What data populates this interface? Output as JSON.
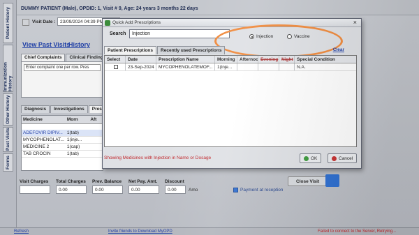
{
  "app": {
    "patient_title": "DUMMY PATIENT (Male), OPDID: 1, Visit # 9, Age: 24 years 3 months 22 days",
    "visit_date_label": "Visit Date :",
    "visit_date_value": "23/09/2024 04:39 PM"
  },
  "left_tabs": [
    "Patient History",
    "Immunization History",
    "Other History",
    "Past Visits",
    "Forms"
  ],
  "links": {
    "view_past_visits": "View Past Visits",
    "history": "History"
  },
  "complaint_tabs": [
    "Chief Complaints",
    "Clinical Findings"
  ],
  "complaint_placeholder": "Enter complaint one per row. Pres",
  "rx_tabs": [
    "Diagnosis",
    "Investigations",
    "Prescrip"
  ],
  "med_table": {
    "headers": [
      "Medicine",
      "Morn",
      "Aft"
    ],
    "rows": [
      [
        "ADEFOVIR DIPIV...",
        "1(tab)",
        ""
      ],
      [
        "MYCOPHENOLAT...",
        "1(inje...",
        ""
      ],
      [
        "MEDICINE 2",
        "1(cap)",
        ""
      ],
      [
        "TAB CROCIN",
        "1(tab)",
        ""
      ]
    ]
  },
  "billing": {
    "visit_charges_label": "Visit Charges",
    "total_charges_label": "Total Charges",
    "total_charges_value": "0.00",
    "prev_balance_label": "Prev. Balance",
    "prev_balance_value": "0.00",
    "net_pay_label": "Net Pay. Amt.",
    "net_pay_value": "0.00",
    "discount_label": "Discount",
    "discount_value": "0.00",
    "discount_unit": "Amo",
    "payment_at_reception": "Payment at reception",
    "close_visit": "Close Visit"
  },
  "status_bar": {
    "refresh": "Refresh",
    "invite": "Invite friends to Download MyOPD",
    "error": "Failed to connect to the Server, Retrying..."
  },
  "dialog": {
    "title": "Quick Add Prescriptions",
    "close": "×",
    "search_label": "Search",
    "search_value": "Injection",
    "radio_injection": "Injection",
    "radio_vaccine": "Vaccine",
    "tabs": [
      "Patient Prescriptions",
      "Recently used Prescriptions"
    ],
    "clear": "Clear",
    "grid_headers": [
      "Select",
      "Date",
      "Prescription Name",
      "Morning",
      "Afternoon",
      "Evening",
      "Night",
      "Special Condition"
    ],
    "grid_rows": [
      [
        "",
        "23-Sep-2024",
        "MYCOPHENOLATEMOF...",
        "1(inje...",
        "",
        "",
        "",
        "N.A."
      ]
    ],
    "status_message": "Showing Medicines with Injection in Name or Dosage",
    "ok": "OK",
    "cancel": "Cancel"
  },
  "colors": {
    "annotation": "#f08a3c",
    "error_text": "#c0252a",
    "link": "#1f3fa6"
  }
}
